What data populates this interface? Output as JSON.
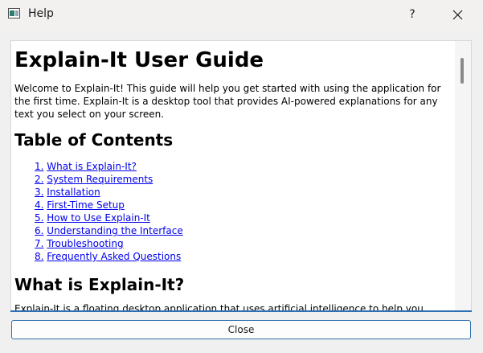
{
  "window": {
    "title": "Help",
    "help_button": "?"
  },
  "doc": {
    "heading": "Explain-It User Guide",
    "intro": "Welcome to Explain-It! This guide will help you get started with using the application for the first time. Explain-It is a desktop tool that provides AI-powered explanations for any text you select on your screen.",
    "toc_heading": "Table of Contents",
    "toc": [
      {
        "num": "1.",
        "label": "What is Explain-It?"
      },
      {
        "num": "2.",
        "label": "System Requirements"
      },
      {
        "num": "3.",
        "label": "Installation"
      },
      {
        "num": "4.",
        "label": "First-Time Setup"
      },
      {
        "num": "5.",
        "label": "How to Use Explain-It"
      },
      {
        "num": "6.",
        "label": "Understanding the Interface"
      },
      {
        "num": "7.",
        "label": "Troubleshooting"
      },
      {
        "num": "8.",
        "label": "Frequently Asked Questions"
      }
    ],
    "section1_heading": "What is Explain-It?",
    "section1_body": "Explain-It is a floating desktop application that uses artificial intelligence to help you"
  },
  "footer": {
    "close_label": "Close"
  },
  "colors": {
    "link": "#0000ee",
    "accent": "#2f6fb3"
  }
}
